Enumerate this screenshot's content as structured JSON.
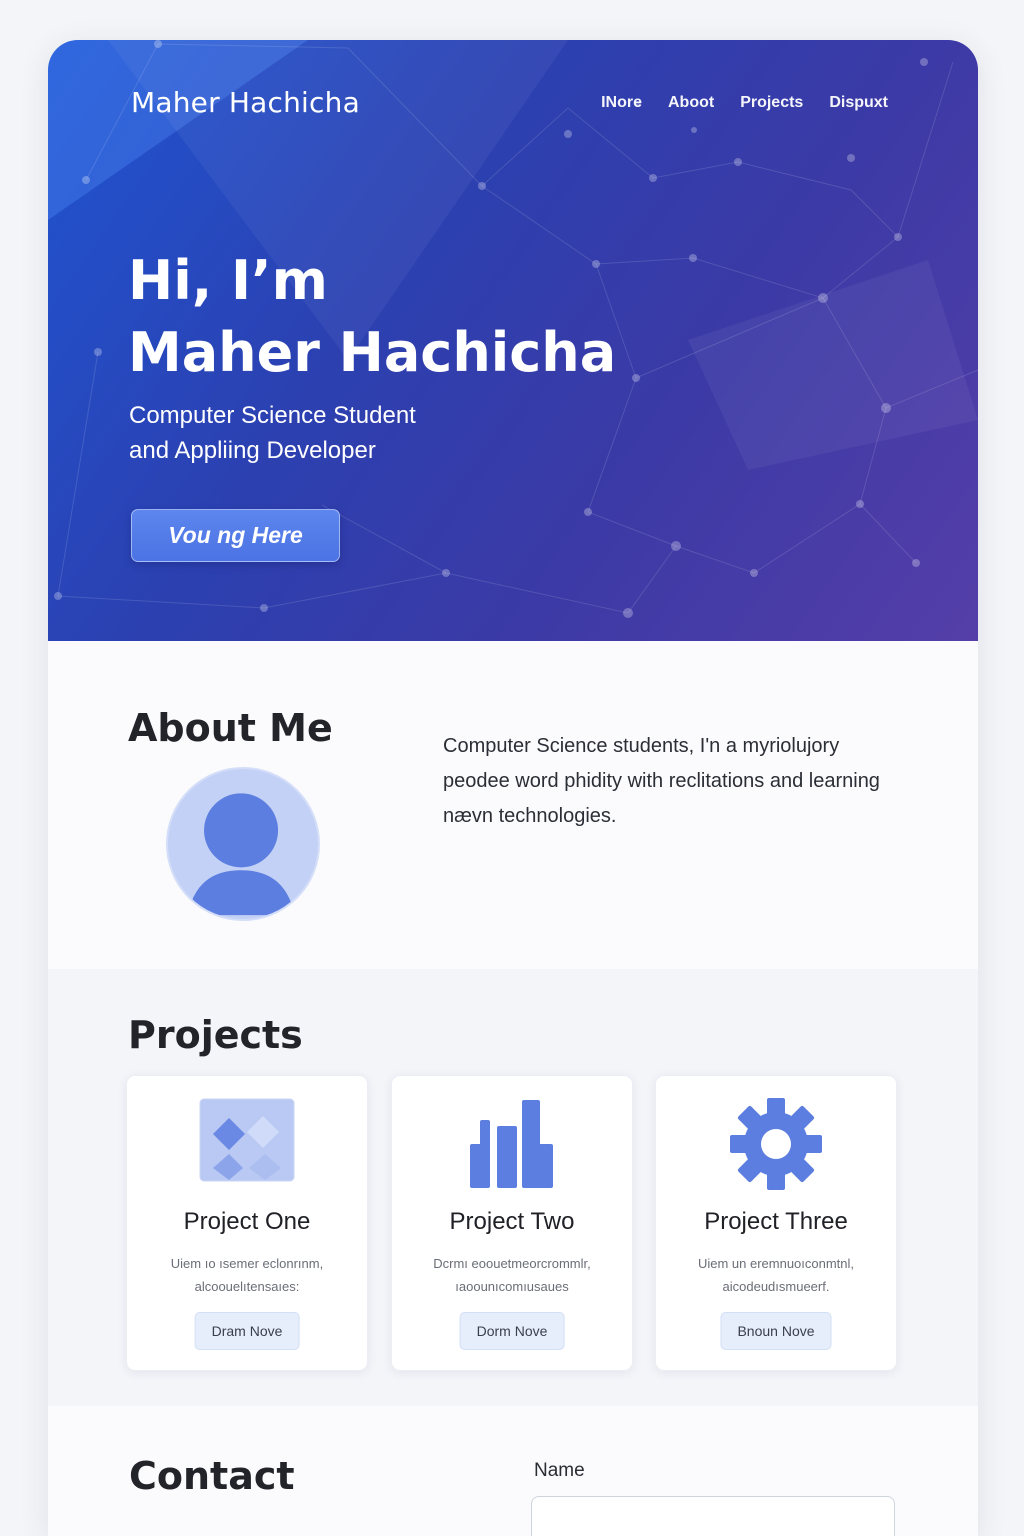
{
  "header": {
    "brand": "Maher Hachicha",
    "nav": [
      "INore",
      "Aboot",
      "Projects",
      "Dispuxt"
    ]
  },
  "hero": {
    "greeting": "Hi, I’m",
    "name": "Maher Hachicha",
    "subtitle_line1": "Computer Science Student",
    "subtitle_line2": "and Appliing Developer",
    "cta_label": "Vou ng Here"
  },
  "about": {
    "title": "About Me",
    "text": "Computer Science students, I'n a myriolujory peodee word phidity with reclitations and learning nævn technologies."
  },
  "projects": {
    "title": "Projects",
    "items": [
      {
        "icon": "image-icon",
        "title": "Project One",
        "desc_line1": "Uiem ıo ısemer eclonrınm,",
        "desc_line2": "alcoouelıtensaıes:",
        "button": "Dram Nove"
      },
      {
        "icon": "bar-chart-icon",
        "title": "Project Two",
        "desc_line1": "Dcrmı eoouetmeorcrommlr,",
        "desc_line2": "ıaoounıcomıusaues",
        "button": "Dorm Nove"
      },
      {
        "icon": "gear-icon",
        "title": "Project Three",
        "desc_line1": "Uiem un eremnuoıconmtnl,",
        "desc_line2": "aicodeudısmueerf.",
        "button": "Bnoun Nove"
      }
    ]
  },
  "contact": {
    "title": "Contact",
    "name_label": "Name",
    "name_value": ""
  },
  "colors": {
    "hero_start": "#1f55d2",
    "hero_end": "#553ea8",
    "accent": "#5a7be0",
    "avatar_bg": "#c3d1f6"
  }
}
